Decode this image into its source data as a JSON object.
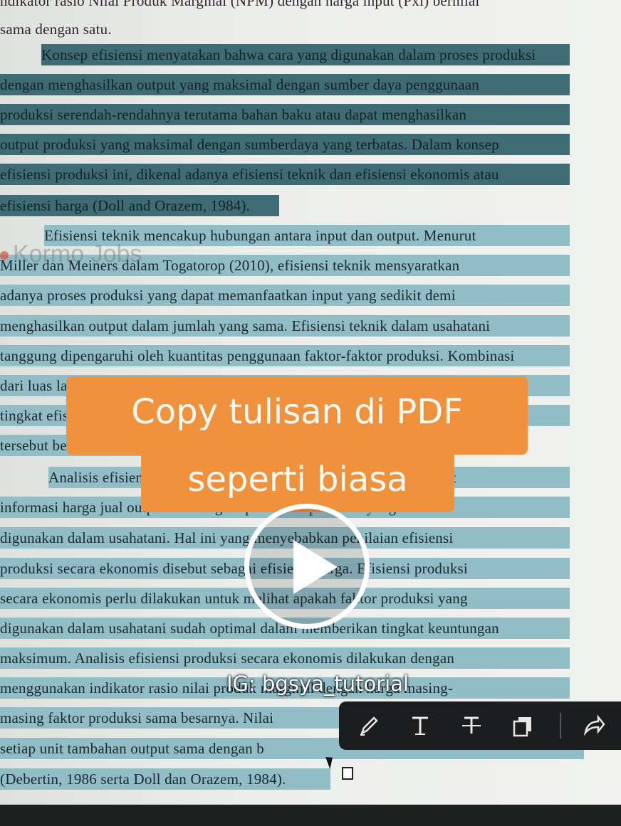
{
  "document": {
    "lines": [
      {
        "text": "ndikator rasio Nilai Produk Marginal (NPM) dengan harga input (Pxi) bernilai",
        "style": "plain"
      },
      {
        "text": "sama dengan satu.",
        "style": "plain"
      },
      {
        "text": "Konsep efisiensi menyatakan bahwa cara yang digunakan dalam proses produksi",
        "style": "dark"
      },
      {
        "text": "dengan menghasilkan output yang maksimal dengan sumber daya penggunaan",
        "style": "dark"
      },
      {
        "text": "produksi serendah-rendahnya terutama bahan baku atau dapat menghasilkan",
        "style": "dark"
      },
      {
        "text": "output produksi yang maksimal dengan sumberdaya yang terbatas. Dalam konsep",
        "style": "dark"
      },
      {
        "text": "efisiensi produksi ini, dikenal adanya efisiensi teknik dan efisiensi ekonomis atau",
        "style": "dark"
      },
      {
        "text": "efisiensi harga (Doll and Orazem, 1984).",
        "style": "dark"
      },
      {
        "text": "Efisiensi teknik mencakup hubungan antara input dan output. Menurut",
        "style": "light"
      },
      {
        "text": "Miller dan Meiners dalam Togatorop (2010), efisiensi teknik mensyaratkan",
        "style": "light"
      },
      {
        "text": "adanya proses produksi yang dapat memanfaatkan input yang sedikit demi",
        "style": "light"
      },
      {
        "text": "menghasilkan output dalam jumlah yang sama. Efisiensi teknik dalam usahatani",
        "style": "light"
      },
      {
        "text": "tanggung dipengaruhi oleh kuantitas penggunaan faktor-faktor produksi. Kombinasi",
        "style": "light"
      },
      {
        "text": "dari luas lahan dan faktor-faktor produksi yang digunakan akan mempengaruhi",
        "style": "light"
      },
      {
        "text": "tingkat efisiensi teknik yang dicapai dalam menghasilkan output produksi",
        "style": "light"
      },
      {
        "text": "tersebut berdasarkan kemampuan petani.",
        "style": "light"
      },
      {
        "text": "Analisis efisiensi produksi secara ekonomis memerlukan prasyarat",
        "style": "light"
      },
      {
        "text": "informasi harga jual output dan harga input faktor produksi yang",
        "style": "light"
      },
      {
        "text": "digunakan dalam usahatani.   Hal ini yang menyebabkan penilaian efisiensi",
        "style": "light"
      },
      {
        "text": "produksi secara ekonomis disebut sebagai efisiensi harga. Efisiensi produksi",
        "style": "light"
      },
      {
        "text": "secara ekonomis perlu dilakukan untuk melihat apakah faktor produksi yang",
        "style": "light"
      },
      {
        "text": "digunakan dalam usahatani sudah optimal dalam memberikan tingkat keuntungan",
        "style": "light"
      },
      {
        "text": "maksimum. Analisis efisiensi produksi secara ekonomis dilakukan dengan",
        "style": "light"
      },
      {
        "text": "menggunakan indikator rasio nilai produk marginal dengan harga masing-",
        "style": "light"
      },
      {
        "text": "masing faktor produksi sama besarnya. Nilai",
        "style": "light"
      },
      {
        "text": "setiap unit tambahan output sama dengan b",
        "style": "light"
      },
      {
        "text": "(Debertin, 1986 serta Doll dan Orazem, 1984).",
        "style": "light"
      }
    ]
  },
  "watermark": "Kormo Jobs",
  "caption": {
    "line1": "Copy tulisan di PDF",
    "line2": "seperti biasa"
  },
  "credit": "IG: bgsya_tutorial",
  "toolbar": {
    "tools": [
      "pen-icon",
      "text-icon",
      "strikethrough-icon",
      "copy-icon",
      "share-icon"
    ]
  },
  "colors": {
    "caption_bg": "#f0913e",
    "highlight_dark": "#3f6b74",
    "highlight_light": "#92bcc6",
    "toolbar_bg": "#1b1d1e"
  }
}
